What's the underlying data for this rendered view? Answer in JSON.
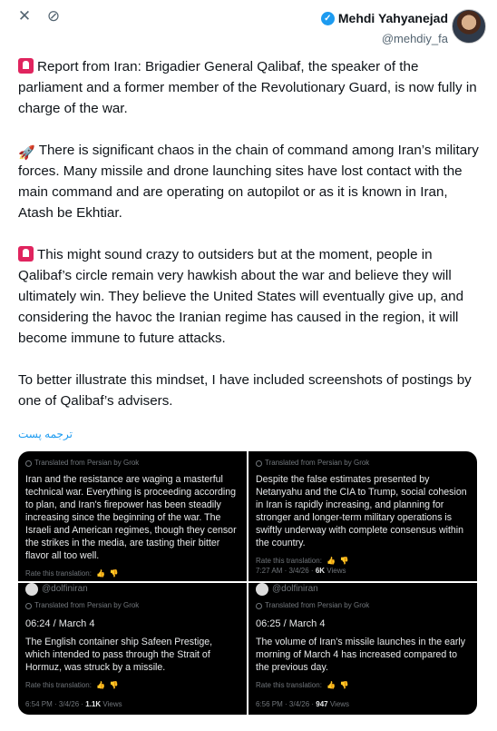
{
  "header": {
    "author_name": "Mehdi Yahyanejad",
    "handle": "@mehdiy_fa",
    "verified_icon": "verified-badge-icon",
    "close_icon": "close-icon",
    "grok_icon": "grok-icon"
  },
  "tweet": {
    "p1": "Report from Iran: Brigadier General Qalibaf, the speaker of the parliament and a former member of the Revolutionary Guard, is now fully in charge of the war.",
    "p2": "There is significant chaos in the chain of command among Iran’s military forces. Many missile and drone launching sites have lost contact with the main command and are operating on autopilot or as it is known in Iran, Atash be Ekhtiar.",
    "p3": "This might sound crazy to outsiders but at the moment, people in Qalibaf’s circle remain very hawkish about the war and believe they will ultimately win. They believe the United States will eventually give up, and considering the havoc the Iranian regime has caused in the region, it will become immune to future attacks.",
    "p4": "To better illustrate this mindset, I have included screenshots of postings by one of Qalibaf’s advisers.",
    "translate_label": "ترجمه پست"
  },
  "cards": {
    "translated_from": "Translated from Persian by Grok",
    "rate": "Rate this translation:",
    "c1": {
      "text": "Iran and the resistance are waging a masterful technical war. Everything is proceeding according to plan, and Iran's firepower has been steadily increasing since the beginning of the war. The Israeli and American regimes, though they censor the strikes in the media, are tasting their bitter flavor all too well."
    },
    "c2": {
      "text": "Despite the false estimates presented by Netanyahu and the CIA to Trump, social cohesion in Iran is rapidly increasing, and planning for stronger and longer-term military operations is swiftly underway with complete consensus within the country.",
      "meta": "7:27 AM · 3/4/26 · ",
      "views": "6K",
      "views_label": " Views"
    },
    "c3": {
      "user": "@dolfiniran",
      "time": "06:24 / March 4",
      "text": "The English container ship Safeen Prestige, which intended to pass through the Strait of Hormuz, was struck by a missile.",
      "meta": "6:54 PM · 3/4/26 · ",
      "views": "1.1K",
      "views_label": " Views"
    },
    "c4": {
      "user": "@dolfiniran",
      "time": "06:25 / March 4",
      "text": "The volume of Iran's missile launches in the early morning of March 4 has increased compared to the previous day.",
      "meta": "6:56 PM · 3/4/26 · ",
      "views": "947",
      "views_label": " Views"
    }
  }
}
